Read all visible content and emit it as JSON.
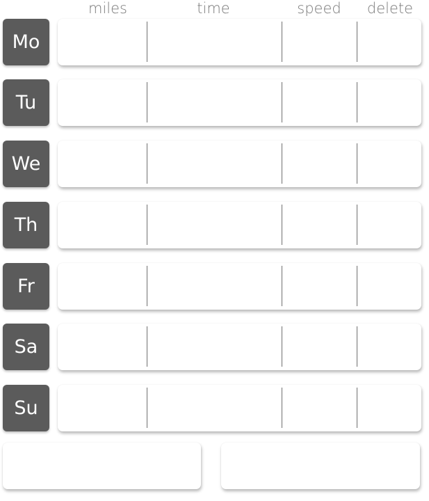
{
  "columns": {
    "miles": "miles",
    "time": "time",
    "speed": "speed",
    "delete": "delete"
  },
  "days": [
    {
      "label": "Mo",
      "miles": "",
      "time": "",
      "speed": ""
    },
    {
      "label": "Tu",
      "miles": "",
      "time": "",
      "speed": ""
    },
    {
      "label": "We",
      "miles": "",
      "time": "",
      "speed": ""
    },
    {
      "label": "Th",
      "miles": "",
      "time": "",
      "speed": ""
    },
    {
      "label": "Fr",
      "miles": "",
      "time": "",
      "speed": ""
    },
    {
      "label": "Sa",
      "miles": "",
      "time": "",
      "speed": ""
    },
    {
      "label": "Su",
      "miles": "",
      "time": "",
      "speed": ""
    }
  ],
  "colors": {
    "day_button_bg": "#5b5b5b",
    "day_button_text": "#ffffff",
    "header_text": "#7a7a7a",
    "divider": "#6f6f6f"
  }
}
